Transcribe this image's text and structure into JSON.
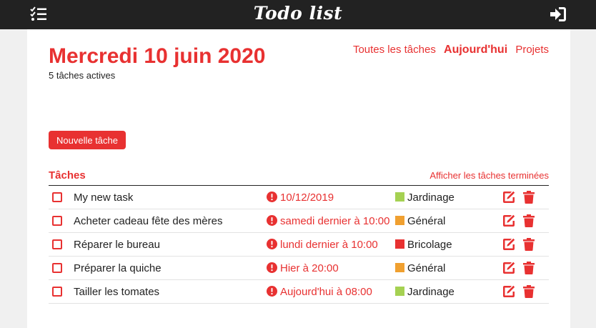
{
  "header": {
    "logo": "Todo list",
    "menu_icon": "checklist-icon",
    "login_icon": "sign-in-icon"
  },
  "page": {
    "title": "Mercredi 10 juin 2020",
    "subtitle": "5 tâches actives"
  },
  "nav": {
    "all": "Toutes les tâches",
    "today": "Aujourd'hui",
    "projects": "Projets"
  },
  "actions": {
    "new_task": "Nouvelle tâche"
  },
  "tasks_section": {
    "title": "Tâches",
    "show_done": "Afficher les tâches terminées"
  },
  "tasks": [
    {
      "name": "My new task",
      "due": "10/12/2019",
      "project": "Jardinage",
      "project_color": "#a5d152"
    },
    {
      "name": "Acheter cadeau fête des mères",
      "due": "samedi dernier à 10:00",
      "project": "Général",
      "project_color": "#f0a030"
    },
    {
      "name": "Réparer le bureau",
      "due": "lundi dernier à 10:00",
      "project": "Bricolage",
      "project_color": "#e83131"
    },
    {
      "name": "Préparer la quiche",
      "due": "Hier à 20:00",
      "project": "Général",
      "project_color": "#f0a030"
    },
    {
      "name": "Tailler les tomates",
      "due": "Aujourd'hui à 08:00",
      "project": "Jardinage",
      "project_color": "#a5d152"
    }
  ],
  "colors": {
    "accent": "#e83131",
    "topbar": "#222222",
    "background": "#f0f0f0"
  },
  "icons": {
    "overdue": "exclamation-circle-icon",
    "edit": "edit-icon",
    "delete": "trash-icon"
  }
}
